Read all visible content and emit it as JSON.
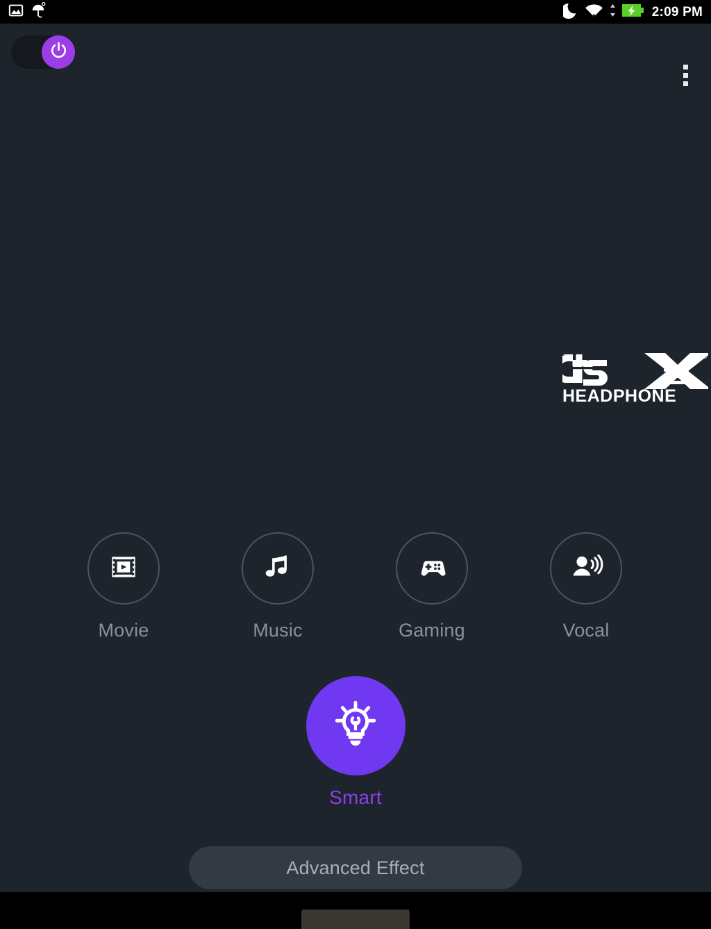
{
  "status_bar": {
    "left_icons": [
      {
        "name": "screenshot-icon",
        "label": "screenshot"
      },
      {
        "name": "umbrella-icon",
        "label": "umbrella"
      }
    ],
    "right_icons": [
      {
        "name": "do-not-disturb-moon-icon",
        "label": "do not disturb"
      },
      {
        "name": "wifi-icon",
        "label": "wifi"
      },
      {
        "name": "data-transfer-arrows-icon",
        "label": "data transfer"
      },
      {
        "name": "battery-charging-icon",
        "label": "battery charging"
      }
    ],
    "clock": "2:09 PM",
    "background": "#000000"
  },
  "top_bar": {
    "power_toggle": {
      "label": "power-toggle",
      "state": "on",
      "icon": "power-icon",
      "thumb_color": "#9b3ee8",
      "track_color": "#15181d"
    },
    "overflow_menu": {
      "label": "more options",
      "icon": "more-vertical-icon"
    }
  },
  "branding": {
    "logo_name": "dts-headphone-x-logo",
    "line1": "dts",
    "line2": "HEADPHONE",
    "mark": "X",
    "trademark": "®"
  },
  "presets": [
    {
      "id": "movie",
      "label": "Movie",
      "icon": "film-play-icon",
      "selected": false
    },
    {
      "id": "music",
      "label": "Music",
      "icon": "music-note-icon",
      "selected": false
    },
    {
      "id": "gaming",
      "label": "Gaming",
      "icon": "gamepad-icon",
      "selected": false
    },
    {
      "id": "vocal",
      "label": "Vocal",
      "icon": "person-speaking-icon",
      "selected": false
    }
  ],
  "smart_preset": {
    "id": "smart",
    "label": "Smart",
    "icon": "lightbulb-idea-icon",
    "selected": true,
    "circle_color": "#7038f0",
    "label_color": "#8b3fe8"
  },
  "advanced_effect": {
    "label": "Advanced Effect",
    "background": "#333a44",
    "text_color": "#a9afb9"
  },
  "theme": {
    "app_background": "#1e242c",
    "accent": "#7038f0",
    "muted_text": "#8b919b",
    "ring": "#4e545d"
  }
}
